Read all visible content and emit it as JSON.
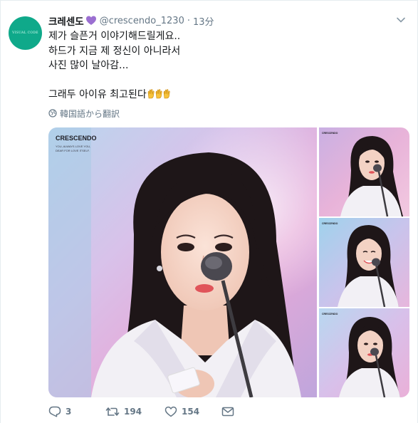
{
  "author": {
    "display_name": "크레센도",
    "handle": "@crescendo_1230",
    "timestamp": "13分",
    "avatar_text": "VISUAL CODE"
  },
  "tweet": {
    "lines": [
      "제가 슬픈거 이야기해드릴게요..",
      "하드가 지금 제 정신이 아니라서",
      "사진 많이 날아감...",
      "",
      "그래두 아이유 최고된다"
    ]
  },
  "translate_label": "韓国語から翻訳",
  "media": {
    "watermark_title": "CRESCENDO",
    "watermark_sub_1": "YOU, ALWAYS LOVE YOU,",
    "watermark_sub_2": "DEAR FOR LOVE ITSELF.",
    "thumb_label": "CRESCENDO"
  },
  "actions": {
    "reply_count": "3",
    "retweet_count": "194",
    "like_count": "154"
  },
  "icons": {
    "heart_emoji": "purple-heart-icon",
    "hands_emoji": "raised-hands-icon",
    "caret": "chevron-down-icon",
    "translate": "globe-icon",
    "reply": "reply-icon",
    "retweet": "retweet-icon",
    "like": "heart-icon",
    "dm": "envelope-icon"
  },
  "colors": {
    "accent_purple": "#9b6fd1",
    "secondary_text": "#657786",
    "avatar_bg": "#0fa98a"
  }
}
